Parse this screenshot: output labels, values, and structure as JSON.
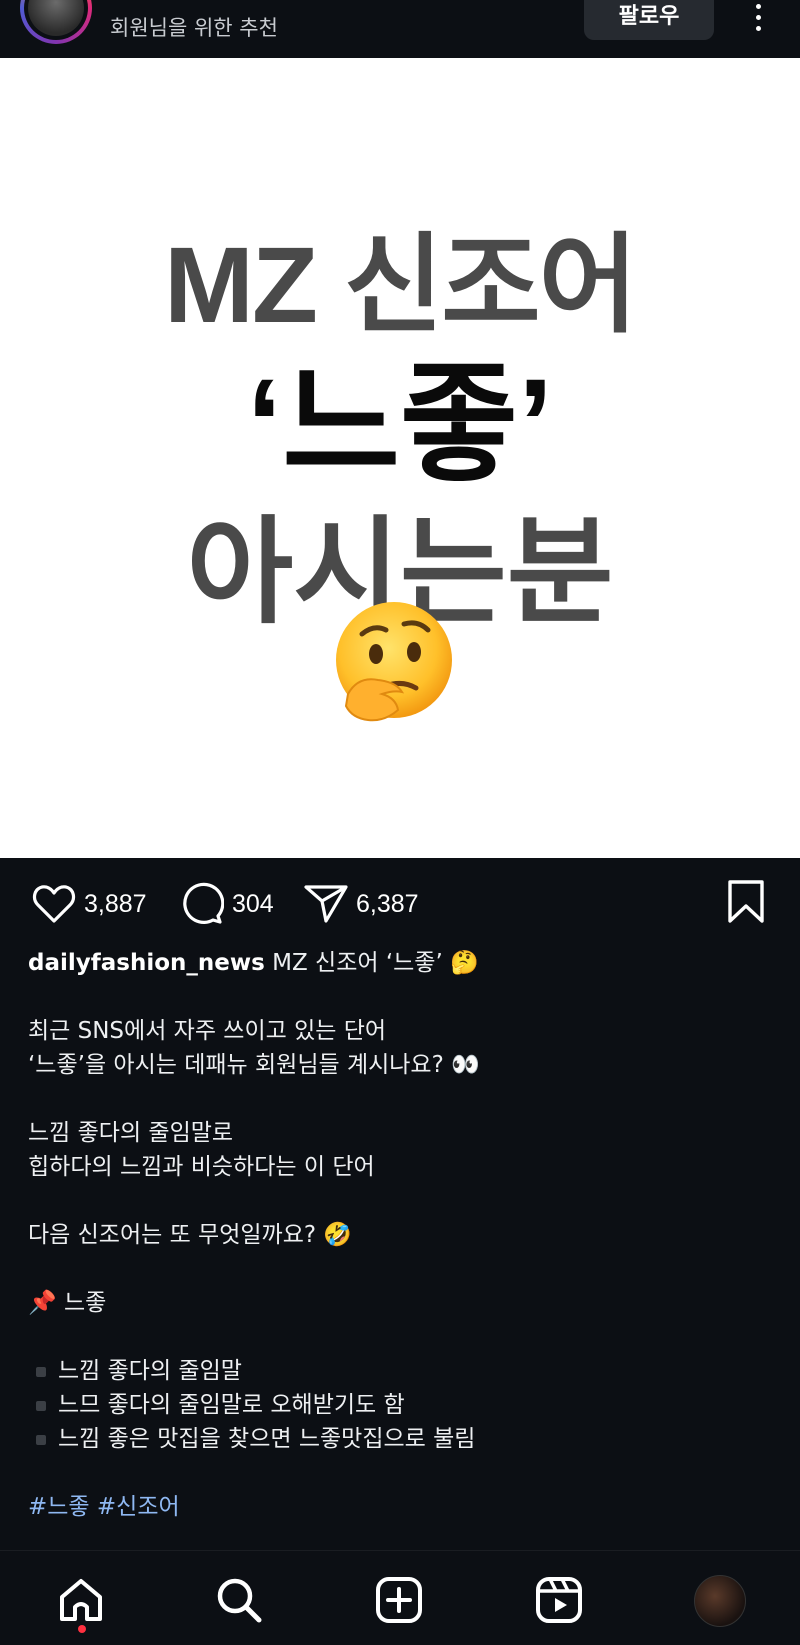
{
  "header": {
    "subtitle": "회원님을 위한 추천",
    "follow_label": "팔로우"
  },
  "post_image": {
    "line1": "MZ 신조어",
    "line2": "‘느좋’",
    "line3": "아시는분",
    "emoji": "thinking-face"
  },
  "actions": {
    "likes": "3,887",
    "comments": "304",
    "shares": "6,387"
  },
  "caption": {
    "username": "dailyfashion_news",
    "headline": "MZ 신조어 ‘느좋’ 🤔",
    "p1_line1": "최근 SNS에서 자주 쓰이고 있는 단어",
    "p1_line2": "‘느좋’을 아시는 데패뉴 회원님들 계시나요? 👀",
    "p2_line1": "느낌 좋다의 줄임말로",
    "p2_line2": "힙하다의 느낌과 비슷하다는 이 단어",
    "p3_line1": "다음 신조어는 또 무엇일까요? 🤣",
    "pin_line": "📌 느좋",
    "bullets": [
      "느낌 좋다의 줄임말",
      "느므 좋다의 줄임말로 오해받기도 함",
      "느낌 좋은 맛집을 찾으면 느좋맛집으로 불림"
    ],
    "hashtags": "#느좋 #신조어"
  },
  "colors": {
    "background": "#0c0f14",
    "hashtag": "#8fb8f2",
    "notification": "#ff3040"
  }
}
